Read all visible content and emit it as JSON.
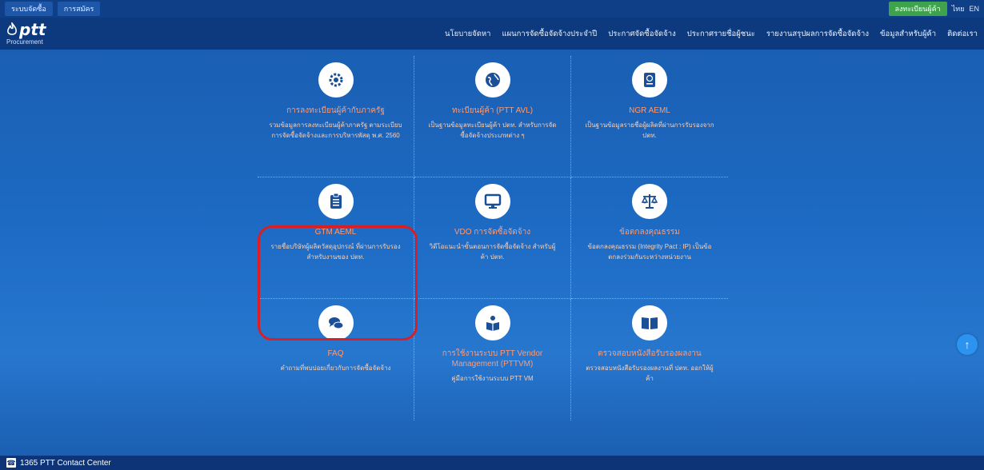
{
  "topbar": {
    "tabs": [
      "ระบบจัดซื้อ",
      "การสมัคร"
    ],
    "register_label": "ลงทะเบียนผู้ค้า",
    "lang_th": "ไทย",
    "lang_en": "EN"
  },
  "header": {
    "brand": "ptt",
    "sub": "Procurement",
    "nav": [
      "นโยบายจัดหา",
      "แผนการจัดซื้อจัดจ้างประจำปี",
      "ประกาศจัดซื้อจัดจ้าง",
      "ประกาศรายชื่อผู้ชนะ",
      "รายงานสรุปผลการจัดซื้อจัดจ้าง",
      "ข้อมูลสำหรับผู้ค้า",
      "ติดต่อเรา"
    ]
  },
  "cards": [
    {
      "title": "การลงทะเบียนผู้ค้ากับภาครัฐ",
      "desc": "รวมข้อมูลการลงทะเบียนผู้ค้าภาครัฐ ตามระเบียบการจัดซื้อจัดจ้างและการบริหารพัสดุ พ.ศ. 2560",
      "icon": "gear-icon"
    },
    {
      "title": "ทะเบียนผู้ค้า (PTT AVL)",
      "desc": "เป็นฐานข้อมูลทะเบียนผู้ค้า ปตท. สำหรับการจัดซื้อจัดจ้างประเภทต่าง ๆ",
      "icon": "globe-icon"
    },
    {
      "title": "NGR AEML",
      "desc": "เป็นฐานข้อมูลรายชื่อผู้ผลิตที่ผ่านการรับรองจาก ปตท.",
      "icon": "passport-icon"
    },
    {
      "title": "GTM AEML",
      "desc": "รายชื่อบริษัทผู้ผลิตวัสดุอุปกรณ์ ที่ผ่านการรับรอง สำหรับงานของ ปตท.",
      "icon": "clipboard-icon"
    },
    {
      "title": "VDO การจัดซื้อจัดจ้าง",
      "desc": "วิดีโอแนะนำขั้นตอนการจัดซื้อจัดจ้าง สำหรับผู้ค้า ปตท.",
      "icon": "monitor-icon"
    },
    {
      "title": "ข้อตกลงคุณธรรม",
      "desc": "ข้อตกลงคุณธรรม (Integrity Pact : IP) เป็นข้อตกลงร่วมกันระหว่างหน่วยงาน",
      "icon": "scale-icon"
    },
    {
      "title": "FAQ",
      "desc": "คำถามที่พบบ่อยเกี่ยวกับการจัดซื้อจัดจ้าง",
      "icon": "chat-icon"
    },
    {
      "title": "การใช้งานระบบ PTT Vendor Management (PTTVM)",
      "desc": "คู่มือการใช้งานระบบ PTT VM",
      "icon": "reader-icon"
    },
    {
      "title": "ตรวจสอบหนังสือรับรองผลงาน",
      "desc": "ตรวจสอบหนังสือรับรองผลงานที่ ปตท. ออกให้ผู้ค้า",
      "icon": "book-icon"
    }
  ],
  "footer": {
    "contact": "1365 PTT Contact Center"
  },
  "colors": {
    "accent_red": "#d81f26",
    "title_orange": "#ff9b73",
    "background_blue": "#1b63b6"
  }
}
